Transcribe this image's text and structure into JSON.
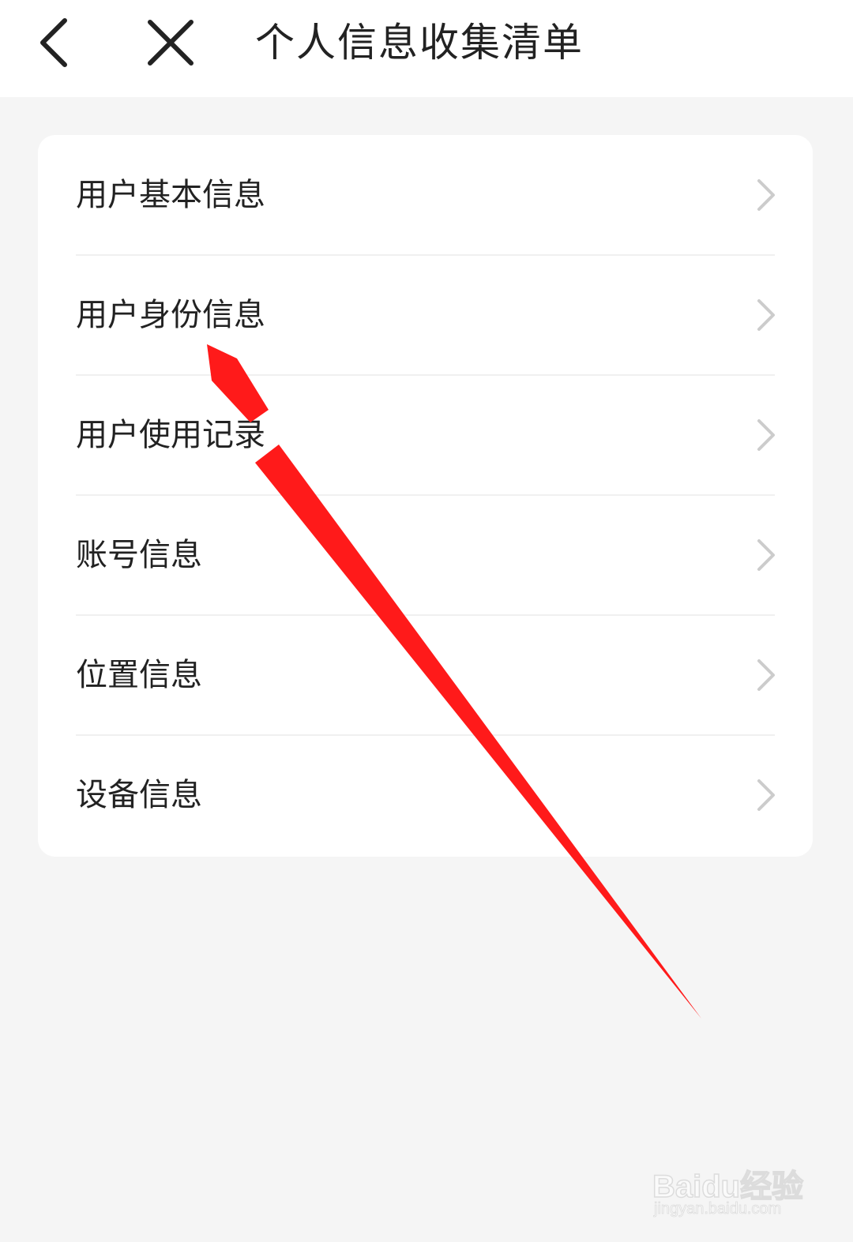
{
  "header": {
    "title": "个人信息收集清单",
    "back_icon": "chevron-left-icon",
    "close_icon": "close-icon"
  },
  "list": {
    "items": [
      {
        "label": "用户基本信息",
        "icon": "chevron-right-icon"
      },
      {
        "label": "用户身份信息",
        "icon": "chevron-right-icon"
      },
      {
        "label": "用户使用记录",
        "icon": "chevron-right-icon"
      },
      {
        "label": "账号信息",
        "icon": "chevron-right-icon"
      },
      {
        "label": "位置信息",
        "icon": "chevron-right-icon"
      },
      {
        "label": "设备信息",
        "icon": "chevron-right-icon"
      }
    ]
  },
  "annotation": {
    "arrow_color": "#ff1a1a"
  },
  "watermark": {
    "brand": "Baidu经验",
    "url": "jingyan.baidu.com"
  },
  "colors": {
    "background": "#f5f5f5",
    "surface": "#ffffff",
    "text": "#222222",
    "chevron": "#cccccc",
    "divider": "#f0f0f0"
  }
}
